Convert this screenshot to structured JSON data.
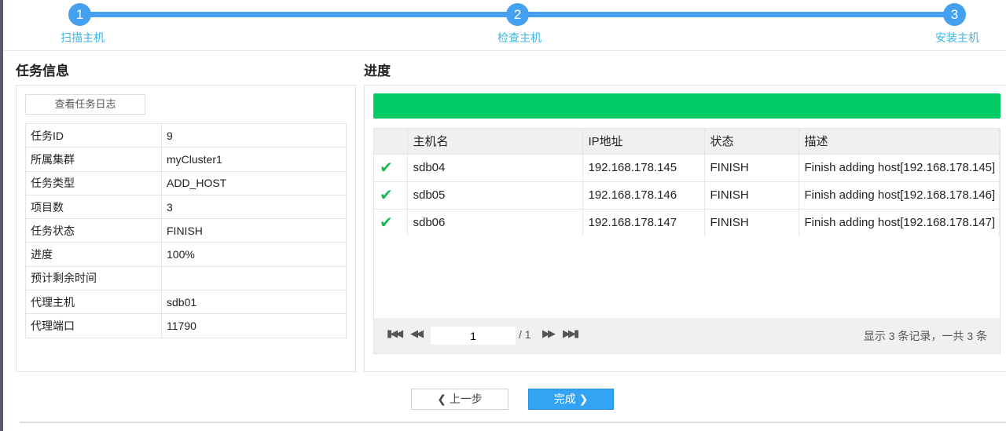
{
  "steps": [
    {
      "num": "1",
      "label": "扫描主机"
    },
    {
      "num": "2",
      "label": "检查主机"
    },
    {
      "num": "3",
      "label": "安装主机"
    }
  ],
  "task_info": {
    "title": "任务信息",
    "log_button": "查看任务日志",
    "rows": [
      [
        "任务ID",
        "9"
      ],
      [
        "所属集群",
        "myCluster1"
      ],
      [
        "任务类型",
        "ADD_HOST"
      ],
      [
        "项目数",
        "3"
      ],
      [
        "任务状态",
        "FINISH"
      ],
      [
        "进度",
        "100%"
      ],
      [
        "预计剩余时间",
        ""
      ],
      [
        "代理主机",
        "sdb01"
      ],
      [
        "代理端口",
        "11790"
      ]
    ]
  },
  "progress": {
    "title": "进度",
    "percent": 100,
    "bar_color": "#00cc66",
    "columns": [
      "",
      "主机名",
      "IP地址",
      "状态",
      "描述"
    ],
    "rows": [
      [
        "sdb04",
        "192.168.178.145",
        "FINISH",
        "Finish adding host[192.168.178.145]"
      ],
      [
        "sdb05",
        "192.168.178.146",
        "FINISH",
        "Finish adding host[192.168.178.146]"
      ],
      [
        "sdb06",
        "192.168.178.147",
        "FINISH",
        "Finish adding host[192.168.178.147]"
      ]
    ],
    "pager": {
      "page": "1",
      "total": "/ 1",
      "summary": "显示 3 条记录，一共 3 条"
    }
  },
  "buttons": {
    "prev": "上一步",
    "finish": "完成"
  }
}
